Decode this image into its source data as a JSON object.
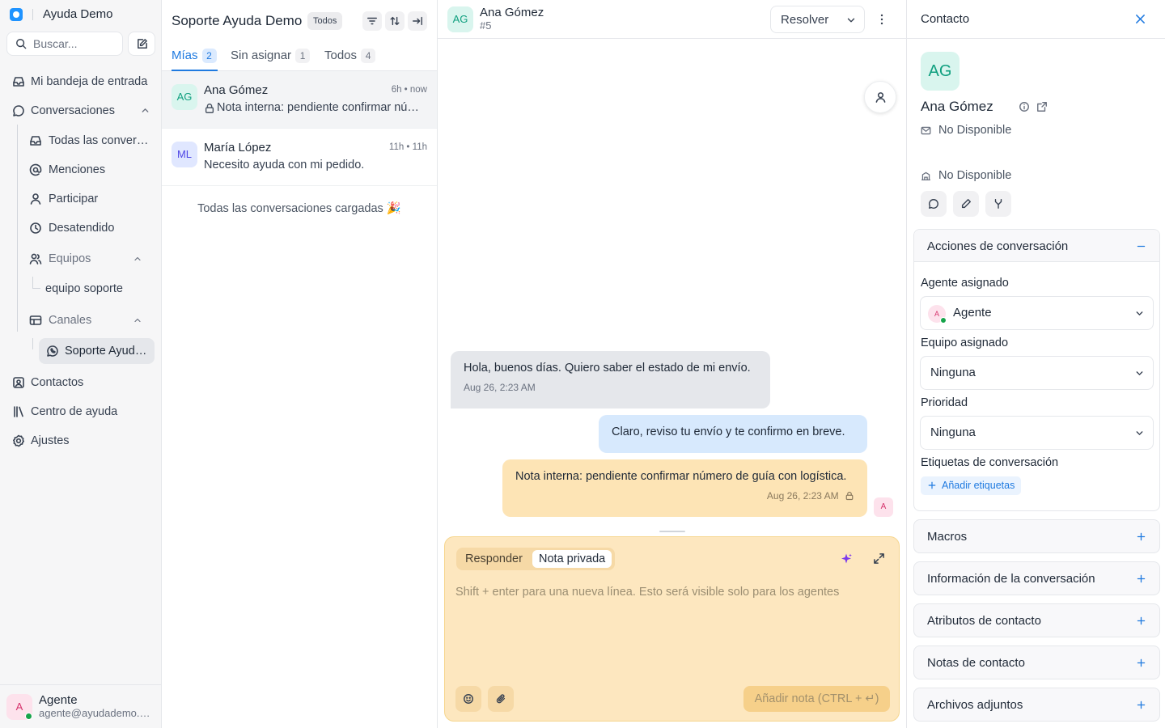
{
  "sidebar": {
    "workspace": "Ayuda Demo",
    "search_placeholder": "Buscar...",
    "nav": {
      "inbox": "Mi bandeja de entrada",
      "conversations": "Conversaciones",
      "all": "Todas las conversaciones",
      "mentions": "Menciones",
      "participating": "Participar",
      "unattended": "Desatendido",
      "teams": "Equipos",
      "team_support": "equipo soporte",
      "channels": "Canales",
      "channel_active": "Soporte Ayuda Demo",
      "contacts": "Contactos",
      "help_center": "Centro de ayuda",
      "settings": "Ajustes"
    },
    "user": {
      "initial": "A",
      "name": "Agente",
      "email": "agente@ayudademo.com"
    }
  },
  "list": {
    "title": "Soporte Ayuda Demo",
    "status_filter": "Todos",
    "tabs": [
      {
        "label": "Mías",
        "count": "2"
      },
      {
        "label": "Sin asignar",
        "count": "1"
      },
      {
        "label": "Todos",
        "count": "4"
      }
    ],
    "conversations": [
      {
        "initials": "AG",
        "name": "Ana Gómez",
        "time": "6h • now",
        "message": "Nota interna: pendiente confirmar número de guía con logística."
      },
      {
        "initials": "ML",
        "name": "María López",
        "time": "11h • 11h",
        "message": "Necesito ayuda con mi pedido."
      }
    ],
    "all_loaded": "Todas las conversaciones cargadas 🎉"
  },
  "conversation": {
    "contact_initials": "AG",
    "contact_name": "Ana Gómez",
    "id": "#5",
    "resolve_label": "Resolver",
    "messages": [
      {
        "type": "incoming",
        "text": "Hola, buenos días. Quiero saber el estado de mi envío.",
        "time": "Aug 26, 2:23 AM"
      },
      {
        "type": "outgoing",
        "text": "Claro, reviso tu envío y te confirmo en breve."
      },
      {
        "type": "private",
        "text": "Nota interna: pendiente confirmar número de guía con logística.",
        "time": "Aug 26, 2:23 AM",
        "sender_initial": "A"
      }
    ],
    "composer": {
      "mode_reply": "Responder",
      "mode_note": "Nota privada",
      "placeholder": "Shift + enter para una nueva línea. Esto será visible solo para los agentes",
      "send_label": "Añadir nota (CTRL + ↵)"
    }
  },
  "contact": {
    "panel_title": "Contacto",
    "initials": "AG",
    "name": "Ana Gómez",
    "email": "No Disponible",
    "company": "No Disponible",
    "actions_title": "Acciones de conversación",
    "assigned_agent_label": "Agente asignado",
    "assigned_agent_initial": "A",
    "assigned_agent": "Agente",
    "assigned_team_label": "Equipo asignado",
    "assigned_team": "Ninguna",
    "priority_label": "Prioridad",
    "priority": "Ninguna",
    "labels_label": "Etiquetas de conversación",
    "add_labels": "Añadir etiquetas",
    "sections": {
      "macros": "Macros",
      "conv_info": "Información de la conversación",
      "contact_attrs": "Atributos de contacto",
      "contact_notes": "Notas de contacto",
      "attachments": "Archivos adjuntos"
    }
  }
}
